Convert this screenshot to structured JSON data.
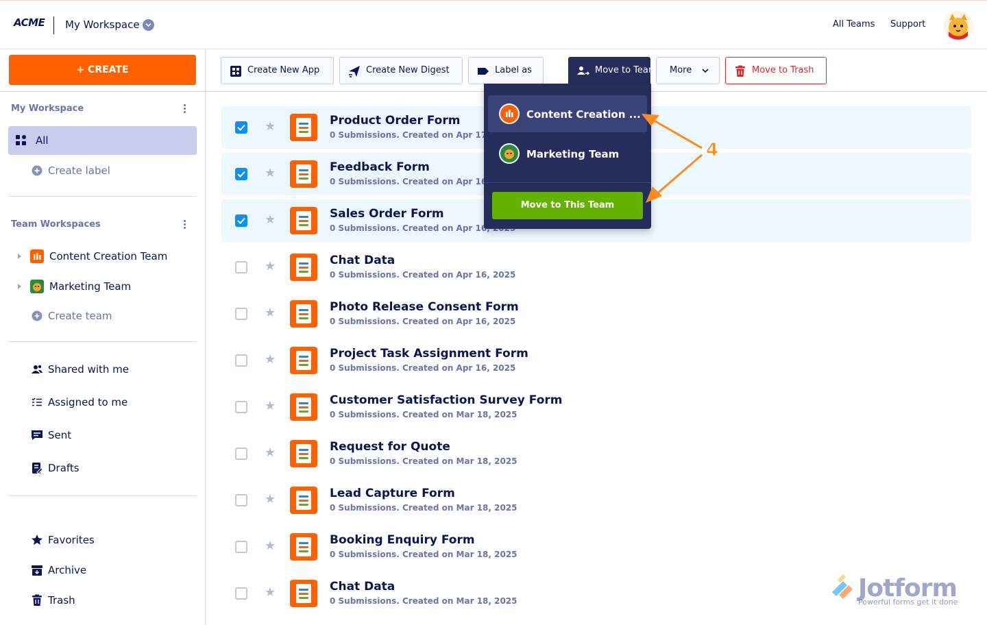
{
  "header": {
    "logo": "ACME",
    "workspace_title": "My Workspace",
    "nav_all_teams": "All Teams",
    "nav_support": "Support"
  },
  "sidebar": {
    "create_label": "+ CREATE",
    "my_workspace_title": "My Workspace",
    "all_label": "All",
    "create_label_link": "Create label",
    "team_workspaces_title": "Team Workspaces",
    "teams": [
      {
        "label": "Content Creation Team",
        "color": "#ff6100"
      },
      {
        "label": "Marketing Team",
        "color": "#2b8a3e"
      }
    ],
    "create_team": "Create team",
    "shared_with_me": "Shared with me",
    "assigned_to_me": "Assigned to me",
    "sent": "Sent",
    "drafts": "Drafts",
    "favorites": "Favorites",
    "archive": "Archive",
    "trash": "Trash"
  },
  "toolbar": {
    "create_new_app": "Create New App",
    "create_new_digest": "Create New Digest",
    "label_as": "Label as",
    "move_to_team": "Move to Team",
    "more": "More",
    "move_to_trash": "Move to Trash"
  },
  "dropdown": {
    "items": [
      "Content Creation ...",
      "Marketing Team"
    ],
    "move_button": "Move to This Team"
  },
  "annotation": {
    "number": "4",
    "color": "#ff8b1c"
  },
  "forms": [
    {
      "title": "Product Order Form",
      "meta": "0 Submissions. Created on Apr 17, 2025",
      "checked": true
    },
    {
      "title": "Feedback Form",
      "meta": "0 Submissions. Created on Apr 16, 2025",
      "checked": true
    },
    {
      "title": "Sales Order Form",
      "meta": "0 Submissions. Created on Apr 16, 2025",
      "checked": true
    },
    {
      "title": "Chat Data",
      "meta": "0 Submissions. Created on Apr 16, 2025",
      "checked": false
    },
    {
      "title": "Photo Release Consent Form",
      "meta": "0 Submissions. Created on Apr 16, 2025",
      "checked": false
    },
    {
      "title": "Project Task Assignment Form",
      "meta": "0 Submissions. Created on Apr 16, 2025",
      "checked": false
    },
    {
      "title": "Customer Satisfaction Survey Form",
      "meta": "0 Submissions. Created on Mar 18, 2025",
      "checked": false
    },
    {
      "title": "Request for Quote",
      "meta": "0 Submissions. Created on Mar 18, 2025",
      "checked": false
    },
    {
      "title": "Lead Capture Form",
      "meta": "0 Submissions. Created on Mar 18, 2025",
      "checked": false
    },
    {
      "title": "Booking Enquiry Form",
      "meta": "0 Submissions. Created on Mar 18, 2025",
      "checked": false
    },
    {
      "title": "Chat Data",
      "meta": "0 Submissions. Created on Mar 18, 2025",
      "checked": false
    }
  ],
  "watermark": {
    "brand": "Jotform",
    "tagline": "Powerful forms get it done"
  },
  "colors": {
    "accent": "#ff6100",
    "navy": "#0a1551",
    "dark_panel": "#252d5b",
    "green": "#64b200",
    "danger": "#e0262c",
    "checkbox": "#0d8ff5"
  }
}
